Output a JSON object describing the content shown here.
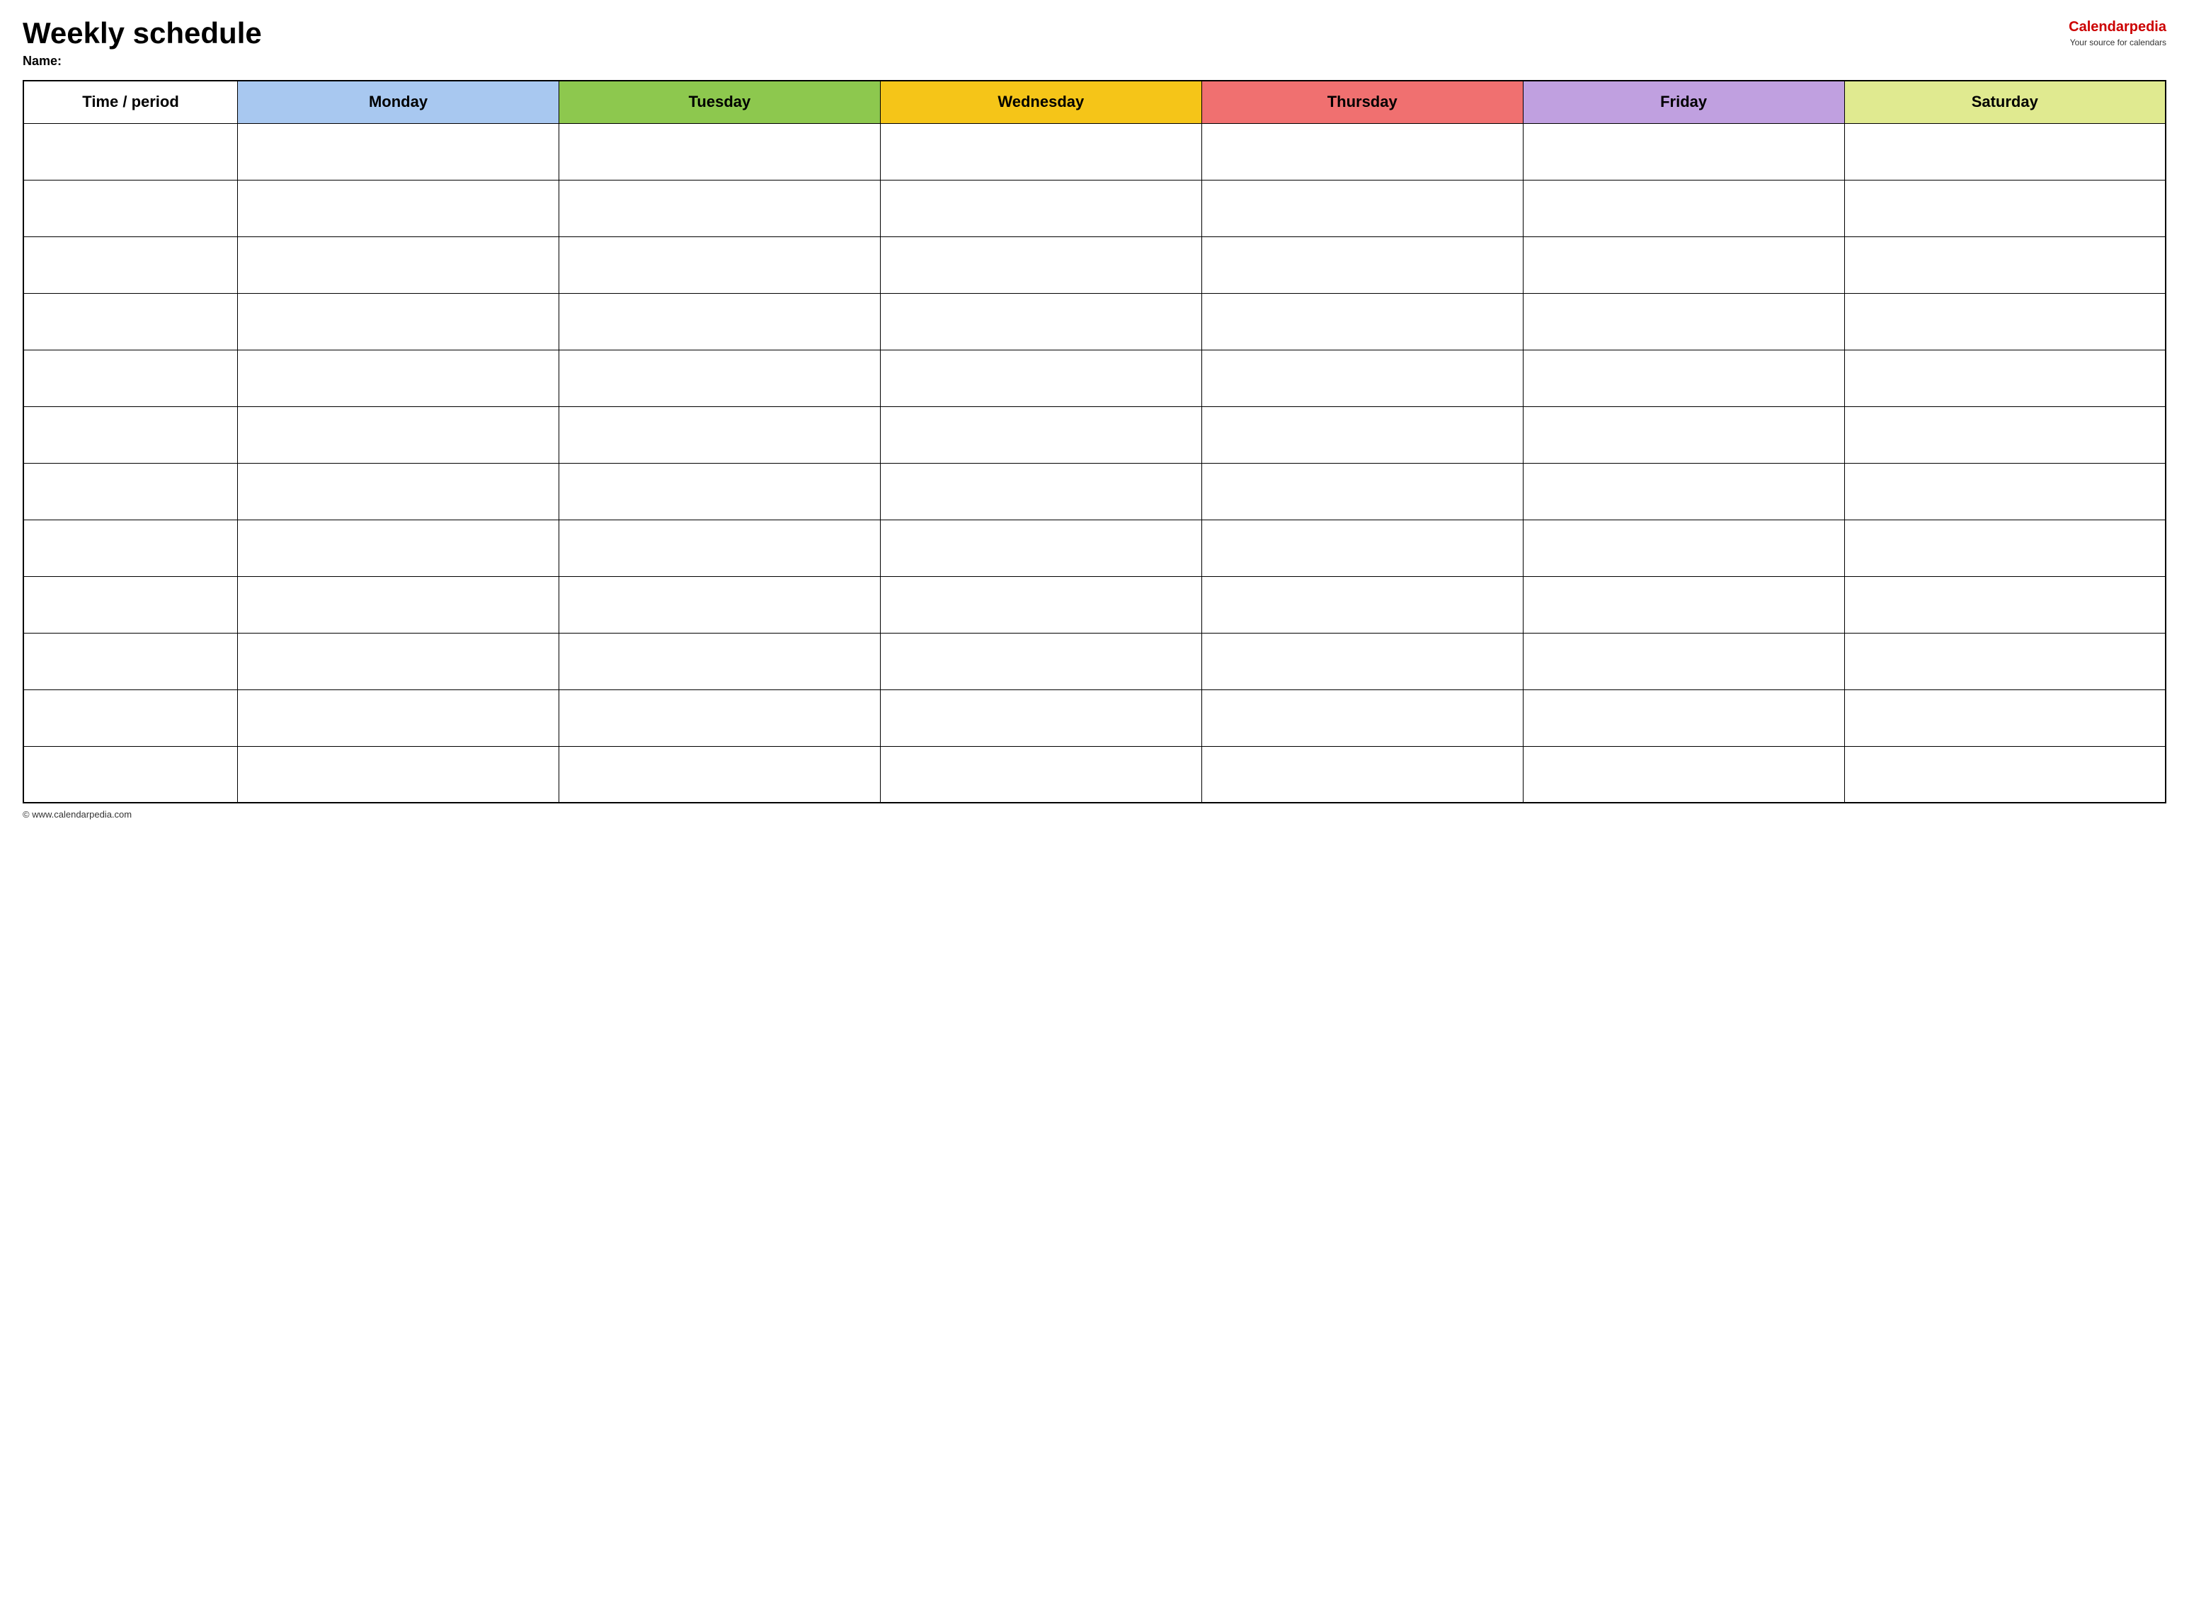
{
  "header": {
    "title": "Weekly schedule",
    "name_label": "Name:",
    "logo_text_black": "Calendar",
    "logo_text_red": "pedia",
    "logo_tagline": "Your source for calendars"
  },
  "table": {
    "columns": [
      {
        "key": "time",
        "label": "Time / period",
        "color": "#ffffff"
      },
      {
        "key": "monday",
        "label": "Monday",
        "color": "#a8c8f0"
      },
      {
        "key": "tuesday",
        "label": "Tuesday",
        "color": "#8dc84e"
      },
      {
        "key": "wednesday",
        "label": "Wednesday",
        "color": "#f5c518"
      },
      {
        "key": "thursday",
        "label": "Thursday",
        "color": "#f07070"
      },
      {
        "key": "friday",
        "label": "Friday",
        "color": "#c0a0e0"
      },
      {
        "key": "saturday",
        "label": "Saturday",
        "color": "#e0ea90"
      }
    ],
    "row_count": 12
  },
  "footer": {
    "url": "© www.calendarpedia.com"
  }
}
